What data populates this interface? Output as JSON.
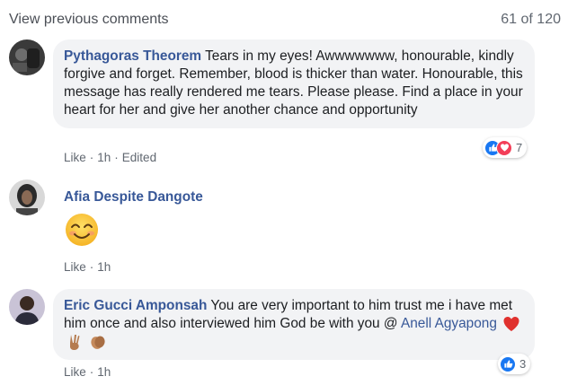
{
  "header": {
    "view_previous": "View previous comments",
    "count": "61 of 120"
  },
  "comments": [
    {
      "author": "Pythagoras Theorem",
      "text": "Tears in my eyes! Awwwwwww, honourable, kindly forgive and forget. Remember, blood is thicker than water. Honourable, this message has really rendered me tears. Please please. Find a place in your heart for her and give her another chance and opportunity",
      "like": "Like",
      "time": "1h",
      "edited": "Edited",
      "reactions": [
        "like-icon",
        "love-icon"
      ],
      "reaction_count": "7"
    },
    {
      "author": "Afia Despite Dangote",
      "emoji": "smiling-face-emoji",
      "like": "Like",
      "time": "1h"
    },
    {
      "author": "Eric Gucci Amponsah",
      "text": "You are very important to him trust me i have met him once and also interviewed him God be with you @",
      "mention": "Anell Agyapong",
      "emojis": [
        "heart-emoji",
        "victory-hand-emoji",
        "clapping-hands-emoji"
      ],
      "like": "Like",
      "time": "1h",
      "reactions": [
        "like-icon"
      ],
      "reaction_count": "3"
    }
  ],
  "colors": {
    "link": "#385898",
    "bubble": "#f2f3f5",
    "meta": "#606770",
    "like_blue": "#1877f2",
    "love_red": "#f33e58"
  }
}
